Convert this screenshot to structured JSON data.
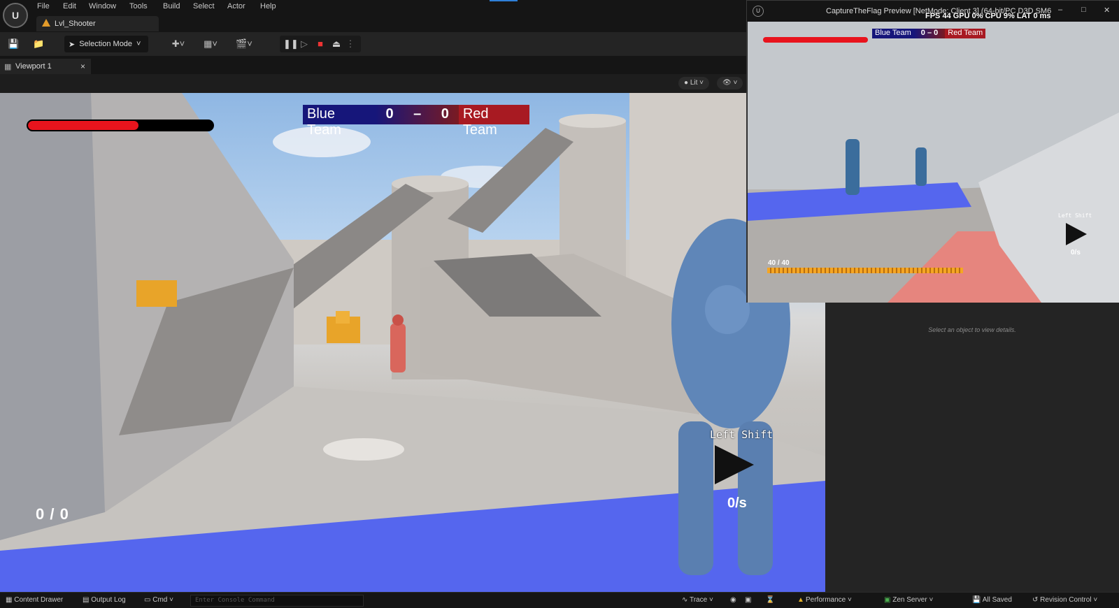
{
  "menubar": {
    "items": [
      "File",
      "Edit",
      "Window",
      "Tools",
      "Build",
      "Select",
      "Actor",
      "Help"
    ],
    "level_tab": "Lvl_Shooter"
  },
  "toolbar": {
    "selection_mode": "Selection Mode"
  },
  "viewport": {
    "tab_label": "Viewport 1",
    "lit_label": "Lit"
  },
  "hud": {
    "health_fraction": 0.6,
    "blue_team": "Blue Team",
    "blue_score": "0",
    "dash": "–",
    "red_score": "0",
    "red_team": "Red Team",
    "ammo": "0 / 0",
    "dash_key": "Left Shift",
    "speed": "0/s"
  },
  "preview": {
    "title": "CaptureTheFlag Preview [NetMode: Client 3]  (64-bit/PC D3D SM6",
    "stats": "FPS  44     GPU  0%     CPU  9%     LAT  0 ms",
    "health_fraction": 1.0,
    "blue_team": "Blue Team",
    "blue_score": "0",
    "red_score": "0",
    "red_team": "Red Team",
    "ammo": "40 / 40",
    "dash_key": "Left Shift",
    "speed": "0/s"
  },
  "details": {
    "hint": "Select an object to view details."
  },
  "statusbar": {
    "content_drawer": "Content Drawer",
    "output_log": "Output Log",
    "cmd": "Cmd",
    "console_placeholder": "Enter Console Command",
    "trace": "Trace",
    "performance": "Performance",
    "zen_server": "Zen Server",
    "all_saved": "All Saved",
    "revision_control": "Revision Control"
  },
  "colors": {
    "team_blue": "#16167a",
    "team_red": "#a81a22",
    "health": "#e8141d",
    "ammo_bar": "#f5a623"
  }
}
